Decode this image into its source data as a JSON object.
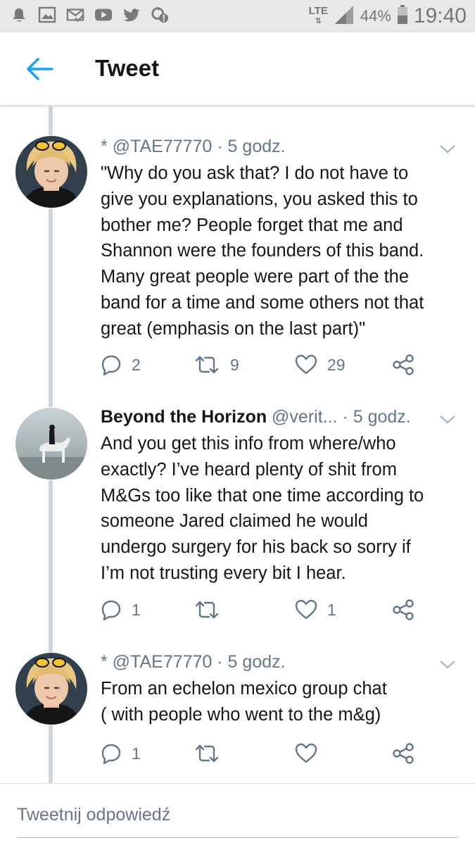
{
  "status_bar": {
    "network": "LTE",
    "battery": "44%",
    "time": "19:40",
    "notification_icons": [
      "alert-bell-icon",
      "image-icon",
      "mail-check-icon",
      "youtube-icon",
      "twitter-icon",
      "sync-alert-icon"
    ]
  },
  "header": {
    "title": "Tweet",
    "back_icon": "back-arrow-icon",
    "accent_color": "#1da1f2"
  },
  "tweets": [
    {
      "name": "",
      "handle": "* @TAE77770",
      "time": " · 5 godz.",
      "avatar": "avatar-blonde-person",
      "text_lines": [
        "\"Why do you ask that? I do not have to",
        "give you explanations, you asked this to",
        "bother me? People forget that me and",
        "Shannon were the founders of this band.",
        "Many great people were part of the the",
        "band for a time and some others not that",
        "great (emphasis on the last part)\""
      ],
      "replies": "2",
      "retweets": "9",
      "likes": "29"
    },
    {
      "name": "Beyond the Horizon",
      "handle": " @verit...",
      "time": " · 5 godz.",
      "avatar": "avatar-rider-on-horse",
      "text_lines": [
        "And you get this info from where/who",
        "exactly? I’ve heard plenty of shit from",
        "M&Gs too like that one time according to",
        "someone Jared claimed he would",
        "undergo surgery for his back so sorry if",
        "I’m not trusting every bit I hear."
      ],
      "replies": "1",
      "retweets": "",
      "likes": "1"
    },
    {
      "name": "",
      "handle": "* @TAE77770",
      "time": " · 5 godz.",
      "avatar": "avatar-blonde-person",
      "text_lines": [
        "From an echelon mexico group chat",
        "( with people who went to the m&g)"
      ],
      "replies": "1",
      "retweets": "",
      "likes": ""
    }
  ],
  "reply_box": {
    "placeholder": "Tweetnij odpowiedź"
  }
}
